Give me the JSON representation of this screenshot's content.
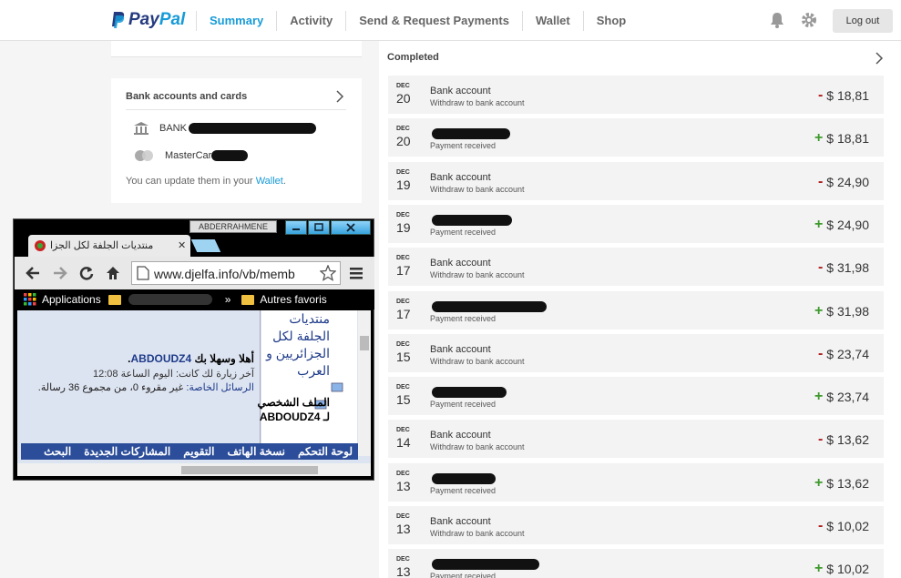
{
  "header": {
    "logo_pay": "Pay",
    "logo_pal": "Pal",
    "nav": [
      "Summary",
      "Activity",
      "Send & Request Payments",
      "Wallet",
      "Shop"
    ],
    "logout": "Log out",
    "icons": [
      "bell-icon",
      "gear-icon"
    ]
  },
  "accounts_card": {
    "title": "Bank accounts and cards",
    "bank_label": "BANK",
    "card_label": "MasterCard",
    "note_prefix": "You can update them in your ",
    "note_link": "Wallet",
    "note_suffix": "."
  },
  "completed": {
    "title": "Completed",
    "transactions": [
      {
        "month": "DEC",
        "day": "20",
        "name": "Bank account",
        "sub": "Withdraw to bank account",
        "sign": "-",
        "amount": "$ 18,81"
      },
      {
        "month": "DEC",
        "day": "20",
        "name": "",
        "sub": "Payment received",
        "sign": "+",
        "amount": "$ 18,81"
      },
      {
        "month": "DEC",
        "day": "19",
        "name": "Bank account",
        "sub": "Withdraw to bank account",
        "sign": "-",
        "amount": "$ 24,90"
      },
      {
        "month": "DEC",
        "day": "19",
        "name": "",
        "sub": "Payment received",
        "sign": "+",
        "amount": "$ 24,90"
      },
      {
        "month": "DEC",
        "day": "17",
        "name": "Bank account",
        "sub": "Withdraw to bank account",
        "sign": "-",
        "amount": "$ 31,98"
      },
      {
        "month": "DEC",
        "day": "17",
        "name": "",
        "sub": "Payment received",
        "sign": "+",
        "amount": "$ 31,98"
      },
      {
        "month": "DEC",
        "day": "15",
        "name": "Bank account",
        "sub": "Withdraw to bank account",
        "sign": "-",
        "amount": "$ 23,74"
      },
      {
        "month": "DEC",
        "day": "15",
        "name": "",
        "sub": "Payment received",
        "sign": "+",
        "amount": "$ 23,74"
      },
      {
        "month": "DEC",
        "day": "14",
        "name": "Bank account",
        "sub": "Withdraw to bank account",
        "sign": "-",
        "amount": "$ 13,62"
      },
      {
        "month": "DEC",
        "day": "13",
        "name": "",
        "sub": "Payment received",
        "sign": "+",
        "amount": "$ 13,62"
      },
      {
        "month": "DEC",
        "day": "13",
        "name": "Bank account",
        "sub": "Withdraw to bank account",
        "sign": "-",
        "amount": "$ 10,02"
      },
      {
        "month": "DEC",
        "day": "13",
        "name": "",
        "sub": "Payment received",
        "sign": "+",
        "amount": "$ 10,02"
      }
    ]
  },
  "chrome": {
    "user": "ABDERRAHMENE",
    "tab_title": "منتديات الجلفة لكل الجزا",
    "url": "www.djelfa.info/vb/memb",
    "bookmarks": {
      "apps": "Applications",
      "more": "»",
      "other": "Autres favoris"
    },
    "page": {
      "welcome_prefix": "أهلا وسهلا بك ",
      "username": "ABDOUDZ4",
      "welcome_suffix": ".",
      "last_visit": "آخر زيارة لك كانت: اليوم الساعة 12:08",
      "pm_label": "الرسائل الخاصة:",
      "pm_text": " غير مقروء 0، من مجموع 36 رسالة.",
      "forum_title": "منتديات الجلفة لكل الجزائريين و العرب",
      "profile_label": "الملف الشخصي لـ ABDOUDZ4",
      "nav_items": [
        "لوحة التحكم",
        "نسخة الهاتف",
        "التقويم",
        "المشاركات الجديدة",
        "البحث"
      ]
    }
  },
  "colors": {
    "accent": "#179bd7",
    "brand_dark": "#253b80",
    "negative": "#b01e1e",
    "positive": "#3e9a2c"
  }
}
